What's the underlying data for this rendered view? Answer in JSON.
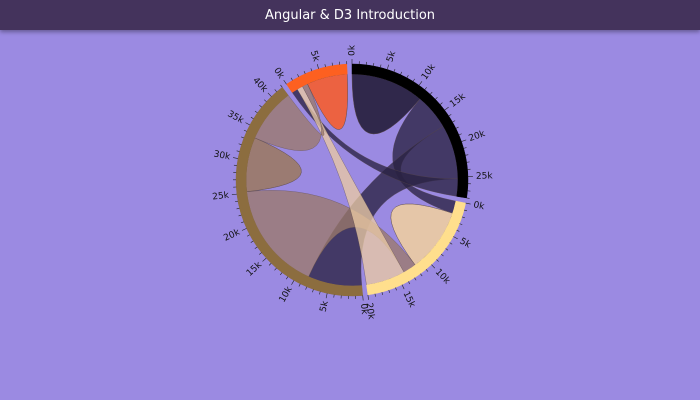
{
  "app": {
    "title": "Angular & D3 Introduction"
  },
  "chart_data": {
    "type": "chord",
    "unit_step": 1000,
    "groups": [
      {
        "total": 28000,
        "color": "#000000",
        "ribbon_color": "#2a2342"
      },
      {
        "total": 20000,
        "color": "#ffdf8d",
        "ribbon_color": "#e9c9a4"
      },
      {
        "total": 42000,
        "color": "#8c6d3f",
        "ribbon_color": "#9b7a6c"
      },
      {
        "total": 9000,
        "color": "#fd6020",
        "ribbon_color": "#f06038"
      }
    ],
    "matrix": [
      [
        11975,
        5871,
        8916,
        2868
      ],
      [
        1951,
        10048,
        2060,
        6171
      ],
      [
        8010,
        16145,
        8090,
        8045
      ],
      [
        1013,
        990,
        940,
        6907
      ]
    ]
  }
}
